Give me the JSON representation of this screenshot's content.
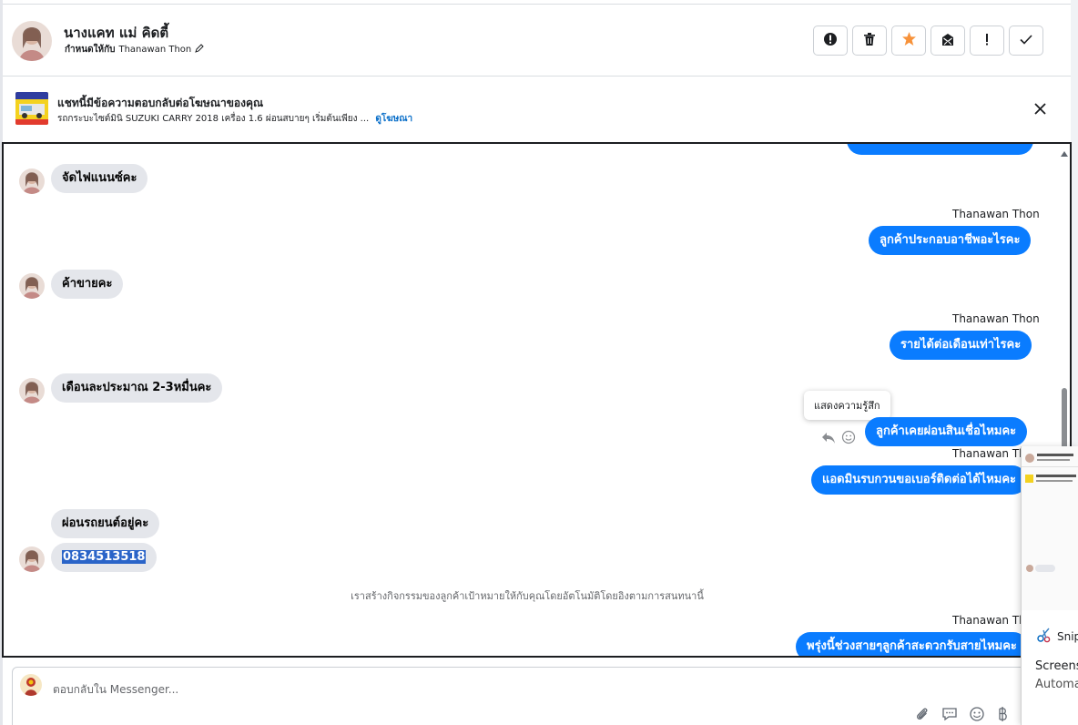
{
  "header": {
    "contact_name": "นางแคท แม่ คิดตี้",
    "assign_prefix": "กำหนดให้กับ",
    "assignee": "Thanawan Thon",
    "toolbar_icons": [
      "spam-icon",
      "trash-icon",
      "star-icon",
      "mark-unread-icon",
      "important-icon",
      "done-icon"
    ]
  },
  "ad": {
    "title": "แชทนี้มีข้อความตอบกลับต่อโฆษณาของคุณ",
    "description": "รถกระบะไซต์มินิ SUZUKI CARRY 2018 เครื่อง 1.6 ผ่อนสบายๆ เริ่มต้นเพียง ...",
    "link": "ดูโฆษณา"
  },
  "chat": {
    "messages": [
      {
        "direction": "in",
        "text": "จัดไฟแนนซ์คะ"
      },
      {
        "direction": "out",
        "sender": "Thanawan Thon",
        "text": "ลูกค้าประกอบอาชีพอะไรคะ"
      },
      {
        "direction": "in",
        "text": "ค้าขายคะ"
      },
      {
        "direction": "out",
        "sender": "Thanawan Thon",
        "text": "รายได้ต่อเดือนเท่าไรคะ"
      },
      {
        "direction": "in",
        "text": "เดือนละประมาณ 2-3หมื่นคะ"
      },
      {
        "direction": "out",
        "text": "ลูกค้าเคยผ่อนสินเชื่อไหมคะ"
      },
      {
        "direction": "out",
        "sender": "Thanawan Thon",
        "text": "แอดมินรบกวนขอเบอร์ติดต่อได้ไหมคะ"
      },
      {
        "direction": "in",
        "text": "ผ่อนรถยนต์อยู่คะ"
      },
      {
        "direction": "in",
        "text": "0834513518"
      },
      {
        "direction": "out",
        "sender": "Thanawan Thon",
        "text": "พรุ่งนี้ช่วงสายๆลูกค้าสะดวกรับสายไหมคะ"
      }
    ],
    "activity_note": "เราสร้างกิจกรรมของลูกค้าเป้าหมายให้กับคุณโดยอัตโนมัติโดยอิงตามการสนทนานี้",
    "tooltip": "แสดงความรู้สึก"
  },
  "composer": {
    "placeholder": "ตอบกลับใน Messenger..."
  },
  "snip_overlay": {
    "app_name": "Snip",
    "line1": "Screens",
    "line2": "Automa"
  },
  "colors": {
    "outgoing_bubble": "#0a7cff",
    "incoming_bubble": "#e4e6eb",
    "link": "#0a6fc9"
  }
}
